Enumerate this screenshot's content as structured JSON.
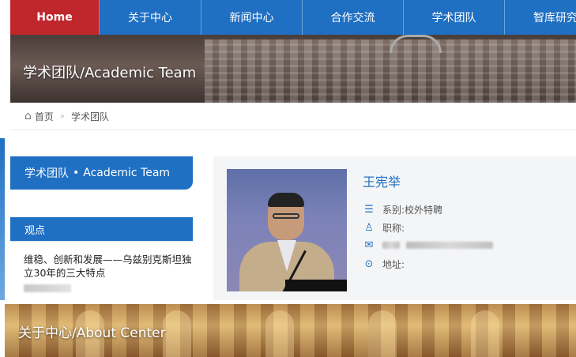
{
  "nav": {
    "items": [
      {
        "label": "Home",
        "active": true
      },
      {
        "label": "关于中心",
        "active": false
      },
      {
        "label": "新闻中心",
        "active": false
      },
      {
        "label": "合作交流",
        "active": false
      },
      {
        "label": "学术团队",
        "active": false
      },
      {
        "label": "智库研究",
        "active": false
      }
    ]
  },
  "hero": {
    "title": "学术团队/Academic Team"
  },
  "breadcrumb": {
    "home": "首页",
    "current": "学术团队"
  },
  "sidebar": {
    "section_cn": "学术团队",
    "section_dot": "•",
    "section_en": "Academic Team",
    "views_heading": "观点",
    "views_article_title": "维稳、创新和发展——乌兹别克斯坦独立30年的三大特点"
  },
  "person": {
    "name": "王宪举",
    "department_label": "系别:",
    "department_value": "校外特聘",
    "title_label": "职称:",
    "address_label": "地址:"
  },
  "footer_banner": {
    "title": "关于中心/About Center"
  },
  "colors": {
    "nav_blue": "#1f6fc2",
    "active_red": "#c0272d"
  },
  "icons": {
    "list": "list-icon",
    "title": "medal-icon",
    "email": "envelope-icon",
    "address": "location-pin-icon",
    "home": "home-icon"
  }
}
